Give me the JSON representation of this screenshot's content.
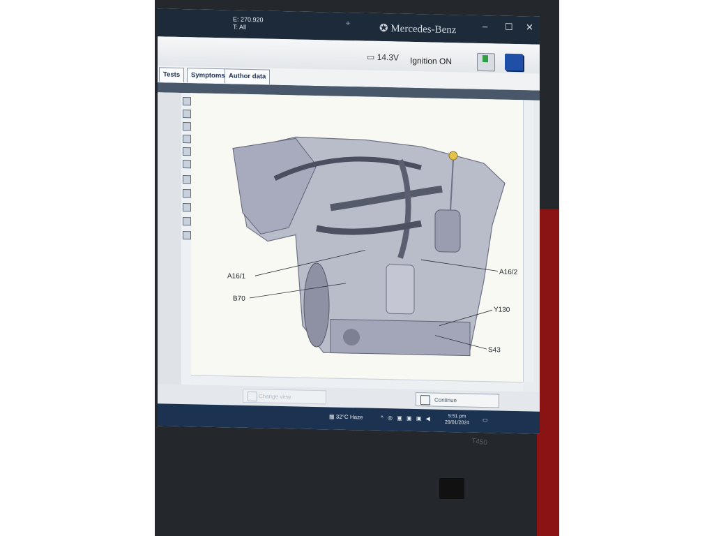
{
  "titlebar": {
    "line1": "E: 270.920",
    "line2": "T: All",
    "brand": "Mercedes-Benz",
    "minimize": "–",
    "maximize": "☐",
    "close": "✕"
  },
  "status": {
    "voltage": "14.3V",
    "ignition": "Ignition ON"
  },
  "tabs": [
    {
      "label": "Tests"
    },
    {
      "label": "Symptoms"
    },
    {
      "label": "Author data"
    }
  ],
  "diagram": {
    "callouts": [
      "A16/1",
      "B70",
      "A16/2",
      "Y130",
      "S43"
    ]
  },
  "buttons": {
    "change": "Change view",
    "continue": "Continue"
  },
  "taskbar": {
    "weather": "32°C Haze",
    "time": "5:51 pm",
    "date": "29/01/2024"
  },
  "laptop": {
    "model": "T450"
  },
  "colors": {
    "titlebar": "#1d2a3a",
    "accent": "#24487a",
    "taskbar": "#1b3350"
  }
}
